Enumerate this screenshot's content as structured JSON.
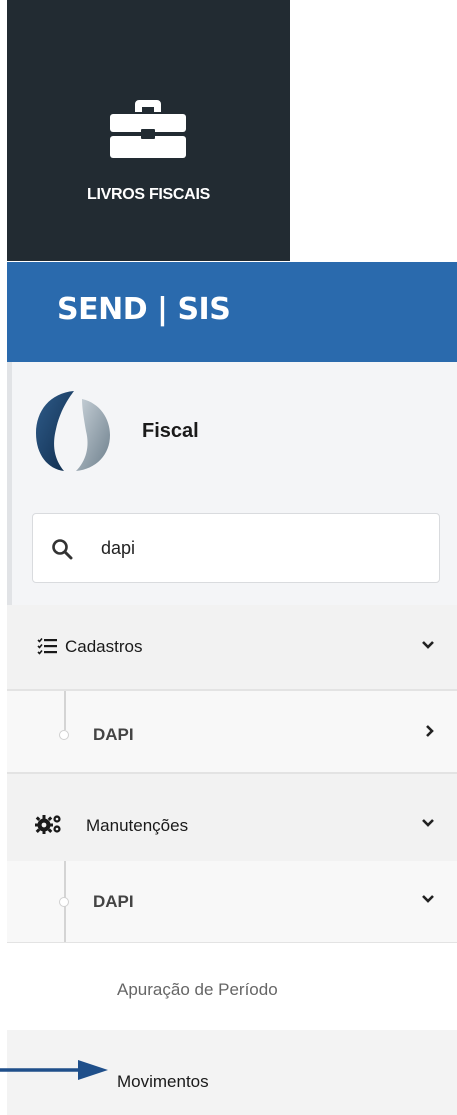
{
  "tile": {
    "label": "LIVROS FISCAIS",
    "icon": "briefcase-icon"
  },
  "header": {
    "title": "SEND | SIS"
  },
  "brand": {
    "module": "Fiscal",
    "logo": "send-logo"
  },
  "search": {
    "value": "dapi",
    "icon": "search-icon"
  },
  "menu": {
    "cadastros": {
      "label": "Cadastros",
      "icon": "checklist-icon",
      "child": {
        "label": "DAPI"
      }
    },
    "manutencoes": {
      "label": "Manutenções",
      "icon": "gears-icon",
      "child": {
        "label": "DAPI",
        "items": [
          "Apuração de Período",
          "Movimentos"
        ]
      }
    }
  },
  "colors": {
    "tile": "#222b32",
    "header": "#2a6aad",
    "arrow": "#1f4f8a"
  }
}
